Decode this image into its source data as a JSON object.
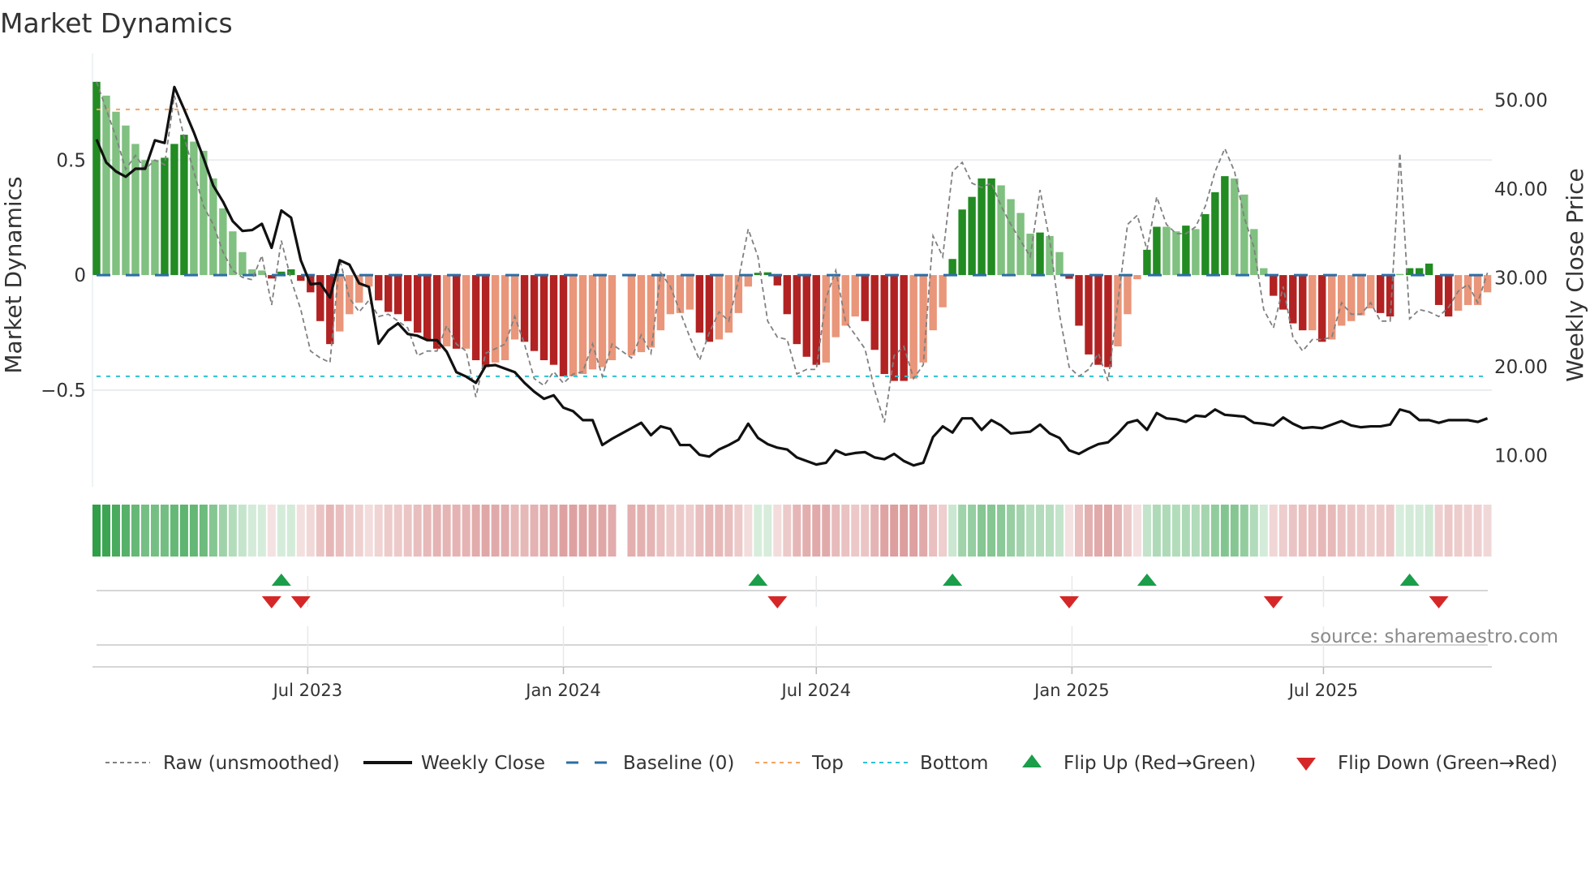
{
  "title": "Market Dynamics",
  "source": "source: sharemaestro.com",
  "legend": [
    {
      "label": "Raw (unsmoothed)",
      "icon": "dashed-gray-line-icon"
    },
    {
      "label": "Weekly Close",
      "icon": "solid-black-line-icon"
    },
    {
      "label": "Baseline (0)",
      "icon": "dashed-blue-line-icon"
    },
    {
      "label": "Top",
      "icon": "dotted-orange-line-icon"
    },
    {
      "label": "Bottom",
      "icon": "dotted-cyan-line-icon"
    },
    {
      "label": "Flip Up (Red→Green)",
      "icon": "triangle-up-icon"
    },
    {
      "label": "Flip Down (Green→Red)",
      "icon": "triangle-down-icon"
    }
  ],
  "colors": {
    "green_dark": "#228b22",
    "green_light": "#80c080",
    "red_dark": "#b22222",
    "red_light": "#e9967a",
    "baseline": "#2b6ea6",
    "top": "#f4a460",
    "bottom": "#29c3d6",
    "raw": "#808080",
    "close": "#111111",
    "flip_up": "#1a9e4a",
    "flip_down": "#d62728",
    "strip_green": "#2e9e45",
    "strip_red": "#c96464",
    "grid": "#e9edf1"
  },
  "chart_data": {
    "type": "bar",
    "title": "Market Dynamics",
    "x_start": "2023-01-30",
    "x_step_days": 7,
    "x_ticks": [
      {
        "label": "Jul 2023",
        "date": "2023-07-01"
      },
      {
        "label": "Jan 2024",
        "date": "2024-01-01"
      },
      {
        "label": "Jul 2024",
        "date": "2024-07-01"
      },
      {
        "label": "Jan 2025",
        "date": "2025-01-01"
      },
      {
        "label": "Jul 2025",
        "date": "2025-07-01"
      }
    ],
    "left_axis": {
      "label": "Market Dynamics",
      "ylim": [
        -0.92,
        0.91
      ],
      "ticks": [
        {
          "value": 0.5,
          "label": "0.5"
        },
        {
          "value": 0,
          "label": "0"
        },
        {
          "value": -0.5,
          "label": "−0.5"
        }
      ]
    },
    "right_axis": {
      "label": "Weekly Close Price",
      "ylim": [
        6.5,
        53.9
      ],
      "ticks": [
        {
          "value": 50,
          "label": "50.00"
        },
        {
          "value": 40,
          "label": "40.00"
        },
        {
          "value": 30,
          "label": "30.00"
        },
        {
          "value": 20,
          "label": "20.00"
        },
        {
          "value": 10,
          "label": "10.00"
        }
      ]
    },
    "baseline": 0,
    "top_threshold": 0.72,
    "bottom_threshold": -0.44,
    "smoothed": [
      0.84,
      0.78,
      0.71,
      0.65,
      0.57,
      0.5,
      0.5,
      0.51,
      0.57,
      0.61,
      0.58,
      0.54,
      0.42,
      0.29,
      0.19,
      0.1,
      0.025,
      0.02,
      -0.015,
      0.015,
      0.025,
      -0.025,
      -0.075,
      -0.2,
      -0.3,
      -0.245,
      -0.17,
      -0.12,
      -0.05,
      -0.11,
      -0.16,
      -0.17,
      -0.2,
      -0.25,
      -0.28,
      -0.32,
      -0.31,
      -0.32,
      -0.32,
      -0.37,
      -0.4,
      -0.38,
      -0.37,
      -0.28,
      -0.29,
      -0.33,
      -0.37,
      -0.39,
      -0.44,
      -0.44,
      -0.43,
      -0.41,
      -0.4,
      -0.37,
      null,
      -0.35,
      -0.335,
      -0.315,
      -0.24,
      -0.17,
      -0.165,
      -0.15,
      -0.25,
      -0.29,
      -0.28,
      -0.25,
      -0.165,
      -0.05,
      0.01,
      0.012,
      -0.045,
      -0.17,
      -0.3,
      -0.355,
      -0.39,
      -0.38,
      -0.27,
      -0.22,
      -0.18,
      -0.2,
      -0.325,
      -0.43,
      -0.46,
      -0.46,
      -0.45,
      -0.38,
      -0.24,
      -0.14,
      0.07,
      0.285,
      0.34,
      0.42,
      0.42,
      0.39,
      0.33,
      0.27,
      0.18,
      0.185,
      0.17,
      0.1,
      -0.016,
      -0.22,
      -0.345,
      -0.39,
      -0.4,
      -0.31,
      -0.17,
      -0.018,
      0.11,
      0.21,
      0.21,
      0.19,
      0.215,
      0.2,
      0.265,
      0.36,
      0.43,
      0.42,
      0.35,
      0.2,
      0.03,
      -0.09,
      -0.15,
      -0.21,
      -0.24,
      -0.24,
      -0.29,
      -0.28,
      -0.22,
      -0.2,
      -0.175,
      -0.145,
      -0.165,
      -0.18,
      0.005,
      0.03,
      0.03,
      0.05,
      -0.13,
      -0.18,
      -0.155,
      -0.13,
      -0.13,
      -0.075
    ],
    "accelerating": [
      1,
      0,
      0,
      0,
      0,
      0,
      0,
      1,
      1,
      1,
      0,
      0,
      0,
      0,
      0,
      0,
      0,
      0,
      1,
      1,
      1,
      1,
      1,
      1,
      1,
      0,
      0,
      0,
      0,
      1,
      1,
      1,
      1,
      1,
      1,
      1,
      0,
      1,
      0,
      1,
      1,
      0,
      0,
      0,
      1,
      1,
      1,
      1,
      1,
      0,
      0,
      0,
      0,
      0,
      0,
      0,
      0,
      0,
      0,
      0,
      0,
      0,
      1,
      1,
      0,
      0,
      0,
      0,
      1,
      1,
      1,
      1,
      1,
      1,
      1,
      0,
      0,
      0,
      0,
      1,
      1,
      1,
      1,
      1,
      0,
      0,
      0,
      0,
      1,
      1,
      1,
      1,
      1,
      0,
      0,
      0,
      0,
      1,
      0,
      0,
      1,
      1,
      1,
      1,
      1,
      0,
      0,
      0,
      1,
      1,
      0,
      0,
      1,
      0,
      1,
      1,
      1,
      0,
      0,
      0,
      0,
      1,
      1,
      1,
      1,
      0,
      1,
      0,
      0,
      0,
      0,
      0,
      1,
      1,
      0,
      1,
      1,
      1,
      1,
      1,
      0,
      0,
      0,
      0
    ],
    "raw": [
      0.84,
      0.72,
      0.6,
      0.46,
      0.52,
      0.46,
      0.5,
      0.48,
      0.78,
      0.6,
      0.45,
      0.3,
      0.22,
      0.1,
      0.02,
      -0.01,
      -0.02,
      0.085,
      -0.13,
      0.15,
      -0.02,
      -0.15,
      -0.33,
      -0.36,
      -0.38,
      0.07,
      -0.1,
      -0.16,
      -0.11,
      -0.18,
      -0.17,
      -0.2,
      -0.23,
      -0.35,
      -0.33,
      -0.33,
      -0.22,
      -0.3,
      -0.33,
      -0.53,
      -0.34,
      -0.32,
      -0.3,
      -0.18,
      -0.3,
      -0.45,
      -0.48,
      -0.42,
      -0.47,
      -0.43,
      -0.42,
      -0.3,
      -0.44,
      -0.3,
      -0.33,
      -0.36,
      -0.26,
      -0.34,
      0.01,
      -0.05,
      -0.16,
      -0.27,
      -0.37,
      -0.25,
      -0.16,
      -0.2,
      -0.02,
      0.2,
      0.08,
      -0.2,
      -0.27,
      -0.28,
      -0.43,
      -0.41,
      -0.41,
      -0.1,
      0.02,
      -0.2,
      -0.26,
      -0.32,
      -0.5,
      -0.64,
      -0.35,
      -0.31,
      -0.45,
      -0.39,
      0.17,
      0.08,
      0.45,
      0.49,
      0.4,
      0.38,
      0.4,
      0.3,
      0.22,
      0.15,
      0.08,
      0.37,
      0.15,
      -0.17,
      -0.4,
      -0.44,
      -0.41,
      -0.34,
      -0.46,
      -0.12,
      0.22,
      0.26,
      0.11,
      0.34,
      0.22,
      0.18,
      0.18,
      0.21,
      0.3,
      0.45,
      0.55,
      0.45,
      0.25,
      0.12,
      -0.15,
      -0.23,
      -0.05,
      -0.27,
      -0.33,
      -0.28,
      -0.28,
      -0.27,
      -0.12,
      -0.17,
      -0.17,
      -0.12,
      -0.2,
      -0.2,
      0.53,
      -0.19,
      -0.15,
      -0.16,
      -0.18,
      -0.14,
      -0.07,
      -0.04,
      -0.12,
      0.01
    ],
    "weekly_close": [
      45.6,
      43.0,
      42.0,
      41.4,
      42.3,
      42.3,
      45.5,
      45.2,
      51.5,
      49.0,
      46.4,
      43.5,
      40.4,
      38.6,
      36.4,
      35.3,
      35.4,
      36.1,
      33.4,
      37.6,
      36.8,
      32.0,
      29.3,
      29.4,
      27.8,
      32.0,
      31.5,
      29.4,
      29.0,
      22.6,
      24.1,
      24.9,
      23.7,
      23.5,
      23.0,
      23.0,
      21.7,
      19.4,
      18.9,
      18.2,
      20.1,
      20.2,
      19.8,
      19.4,
      18.2,
      17.2,
      16.4,
      16.8,
      15.4,
      15.0,
      14.0,
      14.0,
      11.2,
      11.9,
      12.5,
      13.1,
      13.7,
      12.3,
      13.3,
      13.0,
      11.2,
      11.2,
      10.1,
      9.9,
      10.7,
      11.2,
      11.8,
      13.6,
      12.0,
      11.3,
      10.9,
      10.7,
      9.8,
      9.4,
      9.0,
      9.2,
      10.6,
      10.1,
      10.3,
      10.4,
      9.8,
      9.6,
      10.2,
      9.4,
      8.9,
      9.2,
      12.1,
      13.3,
      12.6,
      14.2,
      14.2,
      12.9,
      14.0,
      13.4,
      12.5,
      12.6,
      12.7,
      13.5,
      12.5,
      12.0,
      10.6,
      10.2,
      10.8,
      11.3,
      11.5,
      12.5,
      13.7,
      14.0,
      12.9,
      14.8,
      14.2,
      14.1,
      13.8,
      14.5,
      14.4,
      15.2,
      14.6,
      14.5,
      14.4,
      13.7,
      13.6,
      13.4,
      14.3,
      13.6,
      13.1,
      13.2,
      13.1,
      13.5,
      13.9,
      13.4,
      13.2,
      13.3,
      13.3,
      13.5,
      15.2,
      14.9,
      14.0,
      14.0,
      13.7,
      14.0,
      14.0,
      14.0,
      13.8,
      14.2
    ],
    "flip_up_weeks": [
      19,
      68,
      88,
      108,
      135
    ],
    "flip_down_weeks": [
      18,
      21,
      70,
      100,
      121,
      138
    ],
    "legend_position": "bottom"
  }
}
